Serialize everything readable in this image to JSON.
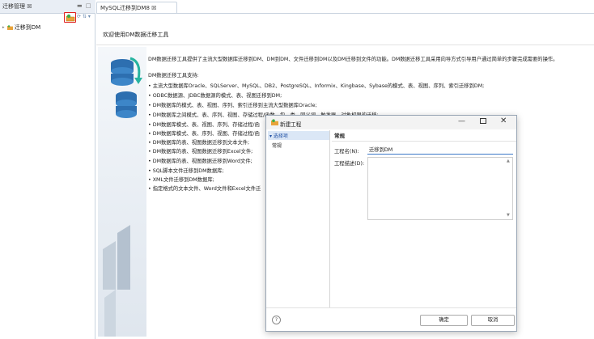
{
  "left_panel": {
    "tab_label": "迁移管理 ☒",
    "tab_controls": "▬ □",
    "toolbar_extra": "⟳ ⇅ ▾",
    "tree": [
      {
        "label": "迁移到DM",
        "icon": "project-folder-icon"
      }
    ]
  },
  "editor": {
    "tab_label": "MySQL迁移到DM8 ☒",
    "welcome": "欢迎使用DM数据迁移工具",
    "description": "DM数据迁移工具提供了主流大型数据库迁移到DM、DM到DM、文件迁移到DM以及DM迁移到文件的功能。DM数据迁移工具采用向导方式引导用户通过简单的步骤完成需要的操作。",
    "support_title": "DM数据迁移工具支持:",
    "features": [
      "主流大型数据库Oracle、SQLServer、MySQL、DB2、PostgreSQL、Informix、Kingbase、Sybase的模式、表、视图、序列、索引迁移到DM;",
      "ODBC数据源、JDBC数据源的模式、表、视图迁移到DM;",
      "DM数据库的模式、表、视图、序列、索引迁移到主流大型数据库Oracle;",
      "DM数据库之间模式、表、序列、视图、存储过程/函数、包、类、同义词、触发器、对象权限的迁移;",
      "DM数据库模式、表、视图、序列、存储过程/函",
      "DM数据库模式、表、序列、视图、存储过程/函",
      "DM数据库的表、视图数据迁移到文本文件;",
      "DM数据库的表、视图数据迁移到Excel文件;",
      "DM数据库的表、视图数据迁移到Word文件;",
      "SQL脚本文件迁移到DM数据库;",
      "XML文件迁移到DM数据库;",
      "指定格式的文本文件、Word文件和Excel文件迁"
    ]
  },
  "dialog": {
    "title": "新建工程",
    "nav": [
      "▾ 选择项",
      "常规"
    ],
    "section_title": "常规",
    "name_label": "工程名(N):",
    "name_value": "迁移到DM",
    "desc_label": "工程描述(D):",
    "help": "?",
    "ok": "确定",
    "cancel": "取消",
    "controls": {
      "minimize": "—",
      "close": "✕"
    }
  },
  "colors": {
    "accent": "#3c78c8",
    "highlight_border": "#e02020",
    "selection": "#dbe7f6"
  }
}
